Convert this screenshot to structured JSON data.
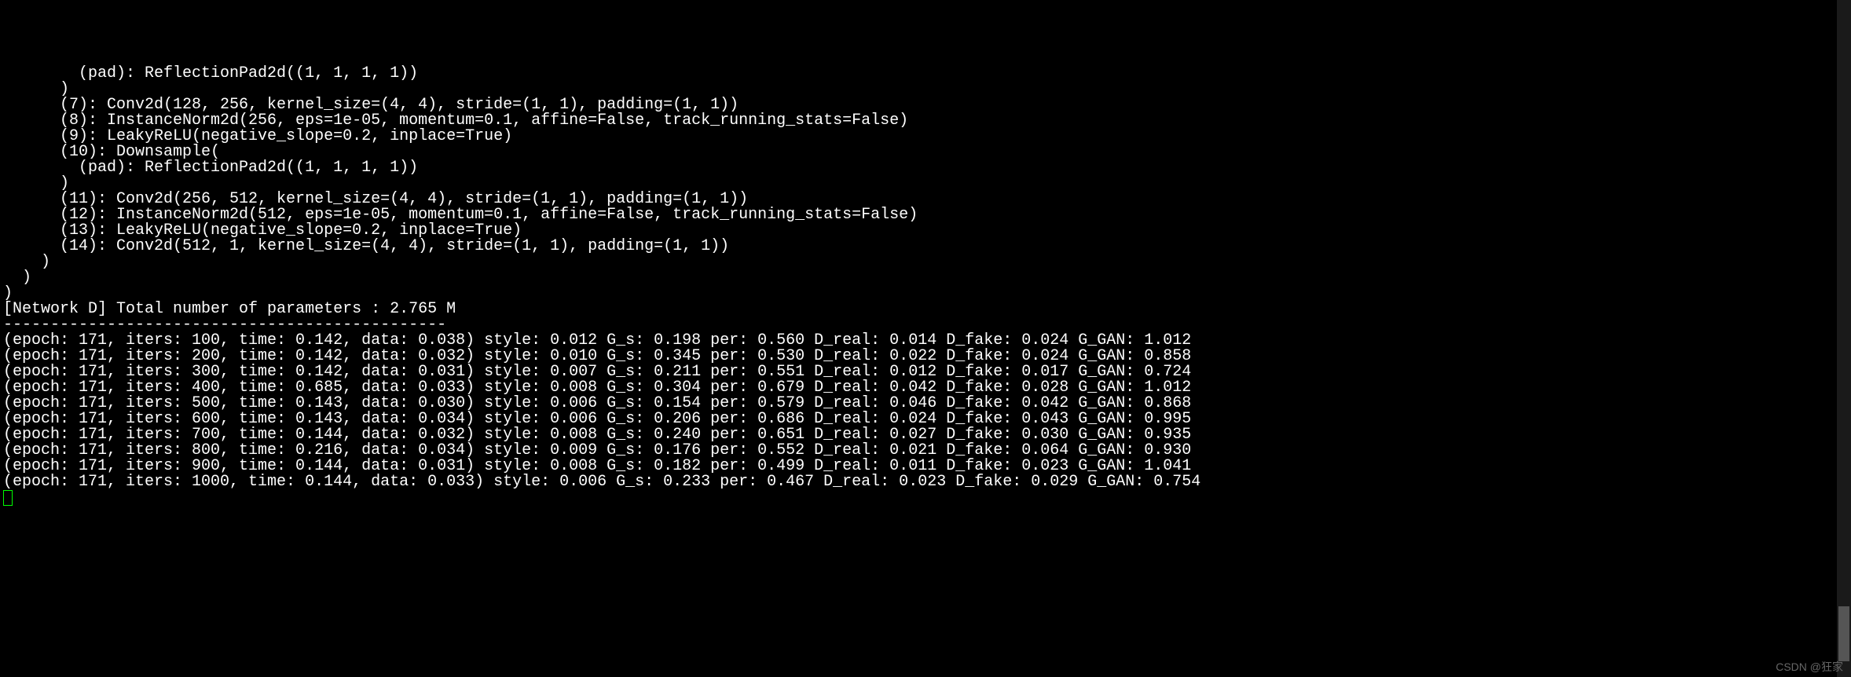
{
  "model_output": {
    "lines": [
      "        (pad): ReflectionPad2d((1, 1, 1, 1))",
      "      )",
      "      (7): Conv2d(128, 256, kernel_size=(4, 4), stride=(1, 1), padding=(1, 1))",
      "      (8): InstanceNorm2d(256, eps=1e-05, momentum=0.1, affine=False, track_running_stats=False)",
      "      (9): LeakyReLU(negative_slope=0.2, inplace=True)",
      "      (10): Downsample(",
      "        (pad): ReflectionPad2d((1, 1, 1, 1))",
      "      )",
      "      (11): Conv2d(256, 512, kernel_size=(4, 4), stride=(1, 1), padding=(1, 1))",
      "      (12): InstanceNorm2d(512, eps=1e-05, momentum=0.1, affine=False, track_running_stats=False)",
      "      (13): LeakyReLU(negative_slope=0.2, inplace=True)",
      "      (14): Conv2d(512, 1, kernel_size=(4, 4), stride=(1, 1), padding=(1, 1))",
      "    )",
      "  )",
      ")",
      "[Network D] Total number of parameters : 2.765 M",
      "-----------------------------------------------"
    ]
  },
  "training_logs": [
    {
      "epoch": 171,
      "iters": 100,
      "time": "0.142",
      "data": "0.038",
      "style": "0.012",
      "G_s": "0.198",
      "per": "0.560",
      "D_real": "0.014",
      "D_fake": "0.024",
      "G_GAN": "1.012"
    },
    {
      "epoch": 171,
      "iters": 200,
      "time": "0.142",
      "data": "0.032",
      "style": "0.010",
      "G_s": "0.345",
      "per": "0.530",
      "D_real": "0.022",
      "D_fake": "0.024",
      "G_GAN": "0.858"
    },
    {
      "epoch": 171,
      "iters": 300,
      "time": "0.142",
      "data": "0.031",
      "style": "0.007",
      "G_s": "0.211",
      "per": "0.551",
      "D_real": "0.012",
      "D_fake": "0.017",
      "G_GAN": "0.724"
    },
    {
      "epoch": 171,
      "iters": 400,
      "time": "0.685",
      "data": "0.033",
      "style": "0.008",
      "G_s": "0.304",
      "per": "0.679",
      "D_real": "0.042",
      "D_fake": "0.028",
      "G_GAN": "1.012"
    },
    {
      "epoch": 171,
      "iters": 500,
      "time": "0.143",
      "data": "0.030",
      "style": "0.006",
      "G_s": "0.154",
      "per": "0.579",
      "D_real": "0.046",
      "D_fake": "0.042",
      "G_GAN": "0.868"
    },
    {
      "epoch": 171,
      "iters": 600,
      "time": "0.143",
      "data": "0.034",
      "style": "0.006",
      "G_s": "0.206",
      "per": "0.686",
      "D_real": "0.024",
      "D_fake": "0.043",
      "G_GAN": "0.995"
    },
    {
      "epoch": 171,
      "iters": 700,
      "time": "0.144",
      "data": "0.032",
      "style": "0.008",
      "G_s": "0.240",
      "per": "0.651",
      "D_real": "0.027",
      "D_fake": "0.030",
      "G_GAN": "0.935"
    },
    {
      "epoch": 171,
      "iters": 800,
      "time": "0.216",
      "data": "0.034",
      "style": "0.009",
      "G_s": "0.176",
      "per": "0.552",
      "D_real": "0.021",
      "D_fake": "0.064",
      "G_GAN": "0.930"
    },
    {
      "epoch": 171,
      "iters": 900,
      "time": "0.144",
      "data": "0.031",
      "style": "0.008",
      "G_s": "0.182",
      "per": "0.499",
      "D_real": "0.011",
      "D_fake": "0.023",
      "G_GAN": "1.041"
    },
    {
      "epoch": 171,
      "iters": 1000,
      "time": "0.144",
      "data": "0.033",
      "style": "0.006",
      "G_s": "0.233",
      "per": "0.467",
      "D_real": "0.023",
      "D_fake": "0.029",
      "G_GAN": "0.754"
    }
  ],
  "watermark": "CSDN @狂家"
}
